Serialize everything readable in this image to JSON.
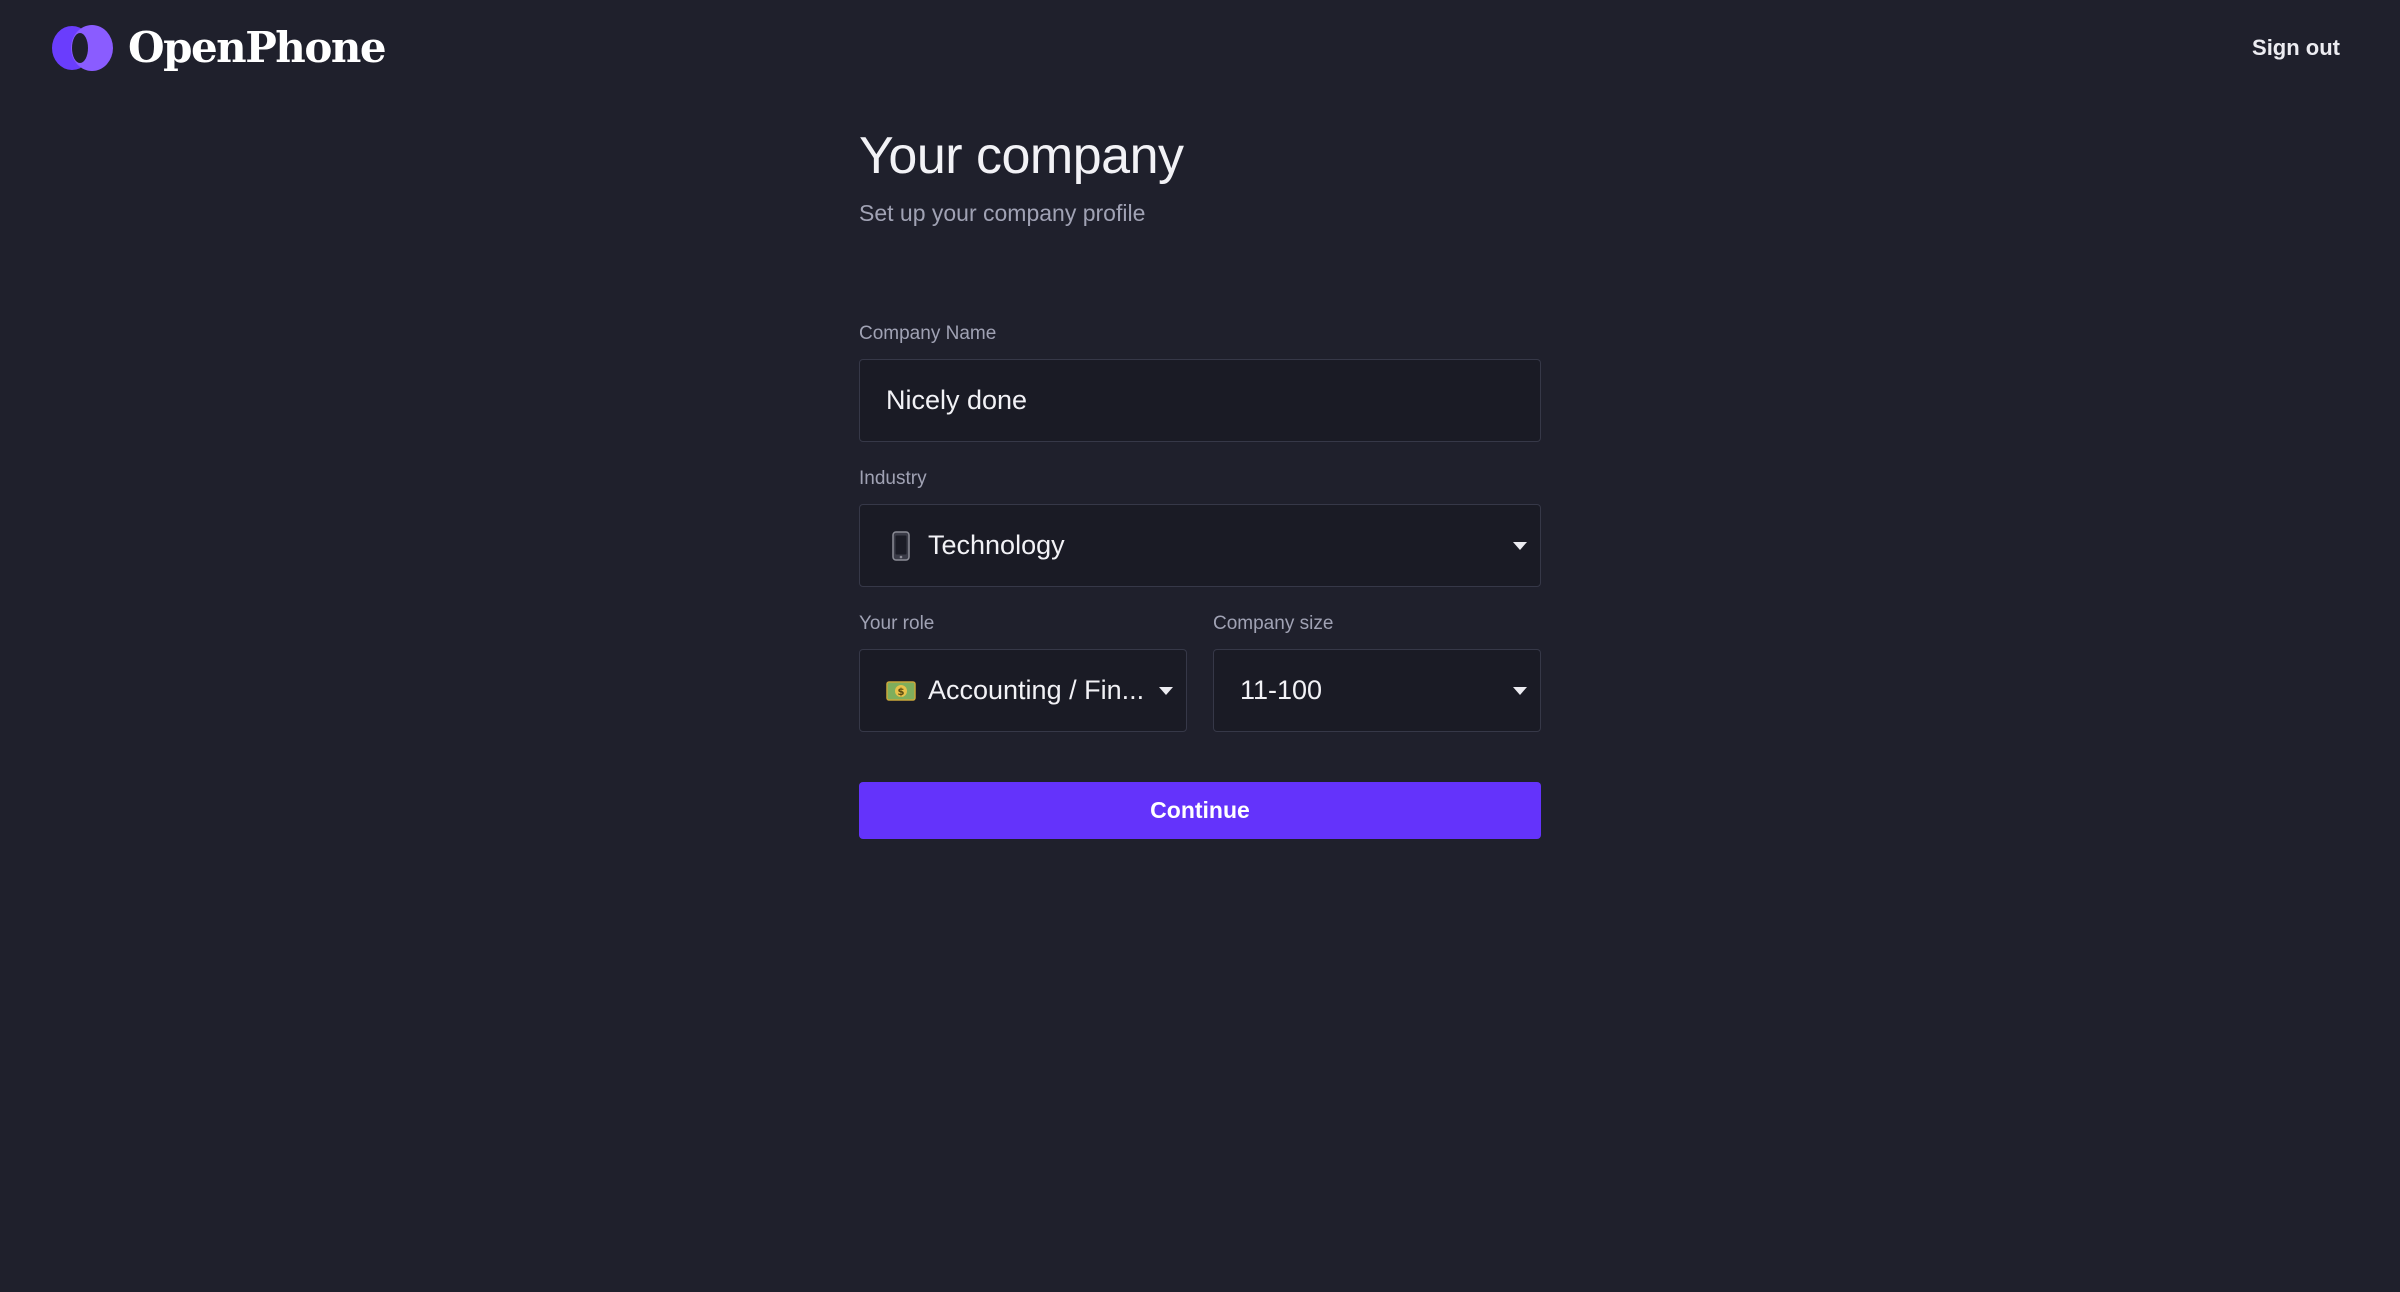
{
  "header": {
    "brand_name": "OpenPhone",
    "sign_out_label": "Sign out"
  },
  "page": {
    "title": "Your company",
    "subtitle": "Set up your company profile"
  },
  "form": {
    "company_name": {
      "label": "Company Name",
      "value": "Nicely done"
    },
    "industry": {
      "label": "Industry",
      "icon": "mobile-phone-icon",
      "value": "Technology"
    },
    "role": {
      "label": "Your role",
      "icon": "money-icon",
      "value": "Accounting / Fin..."
    },
    "company_size": {
      "label": "Company size",
      "value": "11-100"
    },
    "continue_label": "Continue"
  },
  "colors": {
    "background": "#1f202c",
    "field_background": "#1a1b25",
    "field_border": "#363848",
    "accent": "#6433fb",
    "muted_text": "#a0a2b4"
  }
}
